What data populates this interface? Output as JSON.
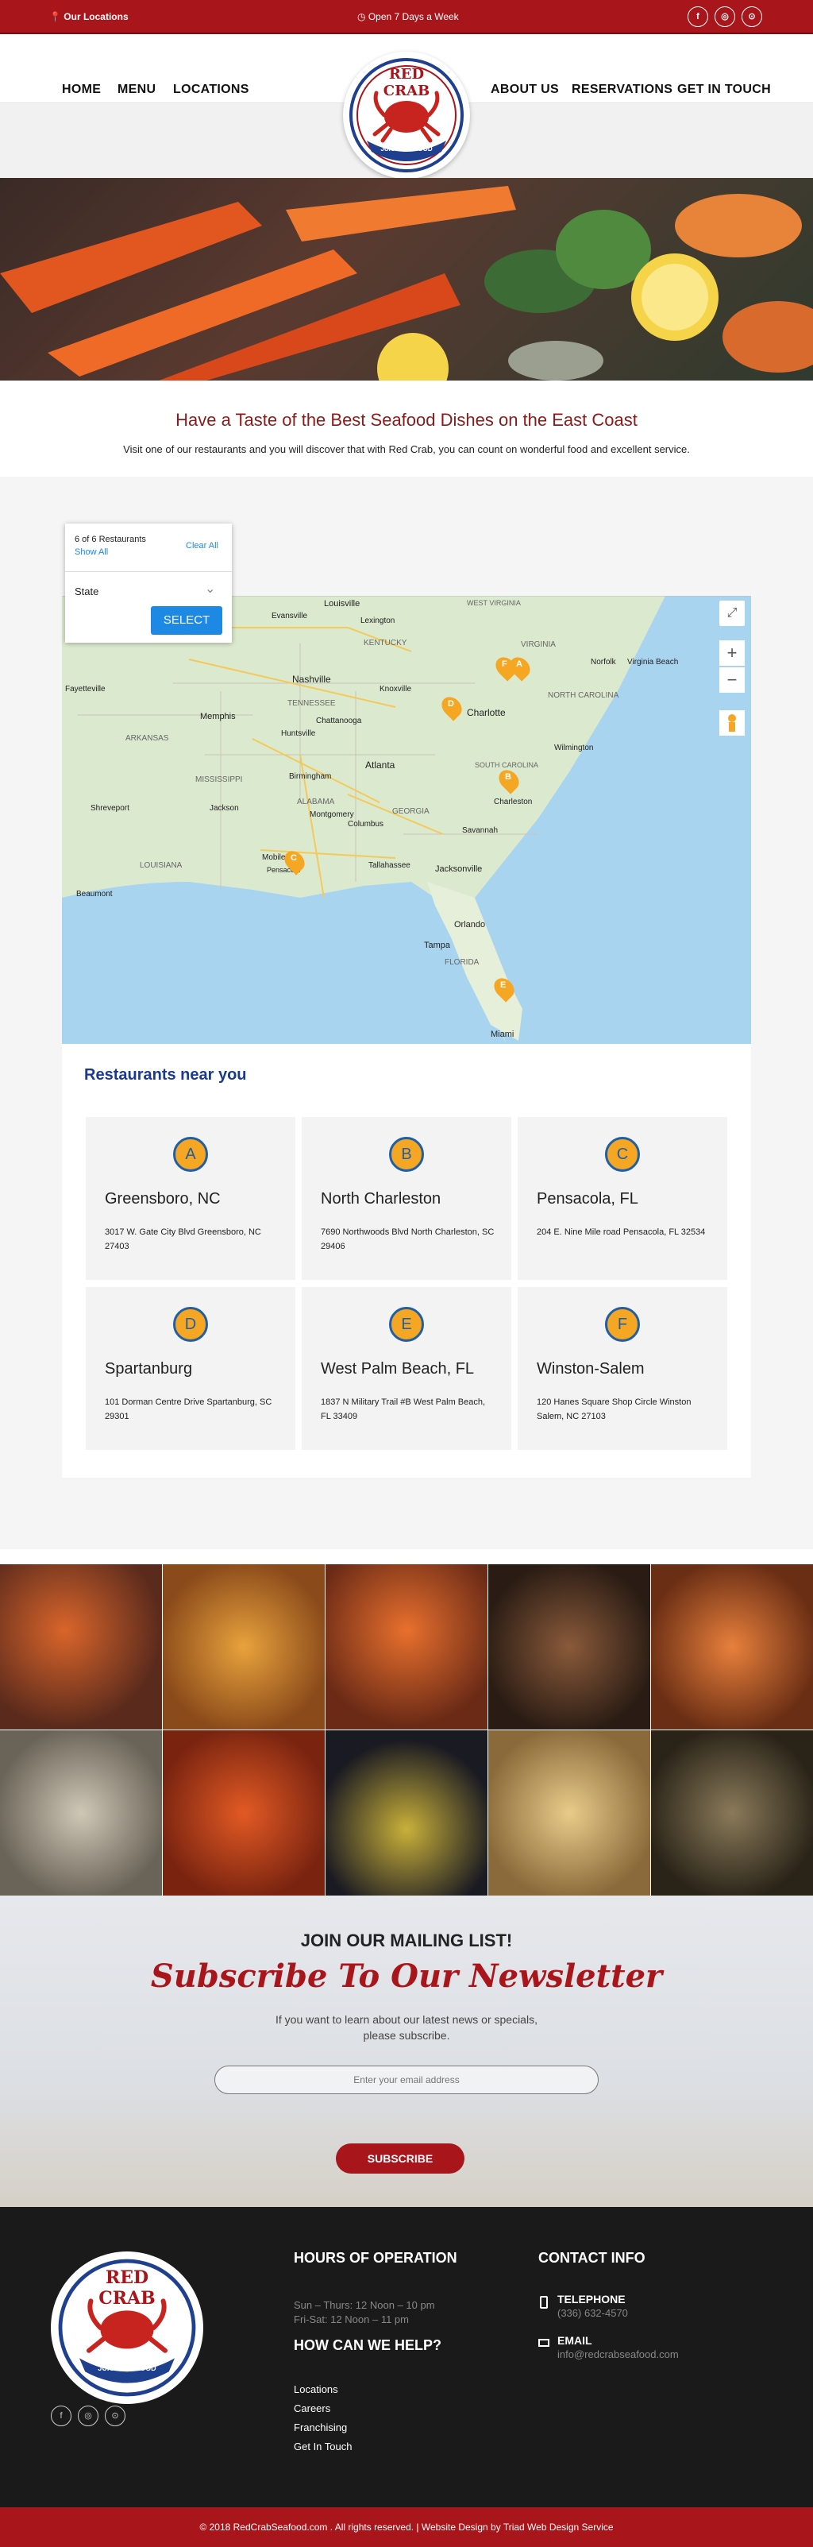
{
  "topbar": {
    "location": "Our Locations",
    "hours": "Open 7 Days a Week"
  },
  "nav": {
    "home": "HOME",
    "menu": "MENU",
    "locations": "LOCATIONS",
    "about": "ABOUT US",
    "reservations": "RESERVATIONS",
    "contact": "GET IN TOUCH"
  },
  "logo": {
    "top": "RED CRAB",
    "bottom": "JUICY SEAFOOD"
  },
  "intro": {
    "title": "Have a Taste of the Best Seafood Dishes on the East Coast",
    "text": "Visit one of our restaurants and you will discover that with Red Crab, you can count on wonderful food and excellent service."
  },
  "finder": {
    "count": "6 of 6 Restaurants",
    "show_all": "Show All",
    "clear_all": "Clear All",
    "state_label": "State",
    "select": "SELECT"
  },
  "map_labels": {
    "louisville": "Louisville",
    "lexington": "Lexington",
    "evansville": "Evansville",
    "kentucky": "KENTUCKY",
    "west_virginia": "WEST VIRGINIA",
    "virginia": "VIRGINIA",
    "norfolk": "Norfolk",
    "virginia_beach": "Virginia Beach",
    "nashville": "Nashville",
    "knoxville": "Knoxville",
    "tennessee": "TENNESSEE",
    "charlotte": "Charlotte",
    "north_carolina": "NORTH CAROLINA",
    "memphis": "Memphis",
    "chattanooga": "Chattanooga",
    "huntsville": "Huntsville",
    "arkansas": "ARKANSAS",
    "mississippi": "MISSISSIPPI",
    "atlanta": "Atlanta",
    "south_carolina": "SOUTH CAROLINA",
    "wilmington": "Wilmington",
    "birmingham": "Birmingham",
    "alabama": "ALABAMA",
    "georgia": "GEORGIA",
    "charleston": "Charleston",
    "shreveport": "Shreveport",
    "jackson": "Jackson",
    "montgomery": "Montgomery",
    "columbus": "Columbus",
    "savannah": "Savannah",
    "louisiana": "LOUISIANA",
    "mobile": "Mobile",
    "tallahassee": "Tallahassee",
    "jacksonville": "Jacksonville",
    "pensacola": "Pensacola",
    "beaumont": "Beaumont",
    "orlando": "Orlando",
    "tampa": "Tampa",
    "florida": "FLORIDA",
    "miami": "Miami",
    "fayetteville": "Fayetteville"
  },
  "map_controls": {
    "fullscreen": "⤢",
    "zoom_in": "+",
    "zoom_out": "−"
  },
  "near": {
    "title": "Restaurants near you",
    "cards": [
      {
        "letter": "A",
        "city": "Greensboro, NC",
        "address": "3017 W. Gate City Blvd Greensboro, NC 27403"
      },
      {
        "letter": "B",
        "city": "North Charleston",
        "address": "7690 Northwoods Blvd North Charleston, SC 29406"
      },
      {
        "letter": "C",
        "city": "Pensacola, FL",
        "address": "204 E. Nine Mile road Pensacola, FL 32534"
      },
      {
        "letter": "D",
        "city": "Spartanburg",
        "address": "101 Dorman Centre Drive Spartanburg, SC 29301"
      },
      {
        "letter": "E",
        "city": "West Palm Beach, FL",
        "address": "1837 N Military Trail #B West Palm Beach, FL 33409"
      },
      {
        "letter": "F",
        "city": "Winston-Salem",
        "address": "120 Hanes Square Shop Circle Winston Salem, NC 27103"
      }
    ]
  },
  "newsletter": {
    "heading": "JOIN OUR MAILING LIST!",
    "script": "Subscribe To Our Newsletter",
    "text1": "If you want to learn about our latest news or specials,",
    "text2": "please subscribe.",
    "placeholder": "Enter your email address",
    "button": "SUBSCRIBE"
  },
  "footer": {
    "hours_title": "HOURS OF OPERATION",
    "hours1": "Sun – Thurs: 12 Noon – 10 pm",
    "hours2": "Fri-Sat: 12 Noon – 11 pm",
    "help_title": "HOW CAN WE HELP?",
    "links": [
      "Locations",
      "Careers",
      "Franchising",
      "Get In Touch"
    ],
    "contact_title": "CONTACT INFO",
    "tel_label": "TELEPHONE",
    "tel": "(336) 632-4570",
    "email_label": "EMAIL",
    "email": "info@redcrabseafood.com"
  },
  "copyright": "© 2018 RedCrabSeafood.com . All rights reserved.  |  Website Design by Triad Web Design Service",
  "colors": {
    "brand_red": "#a8151b",
    "badge": "#f5a623",
    "badge_border": "#1f5fa8",
    "near_title": "#1a3a8c"
  }
}
